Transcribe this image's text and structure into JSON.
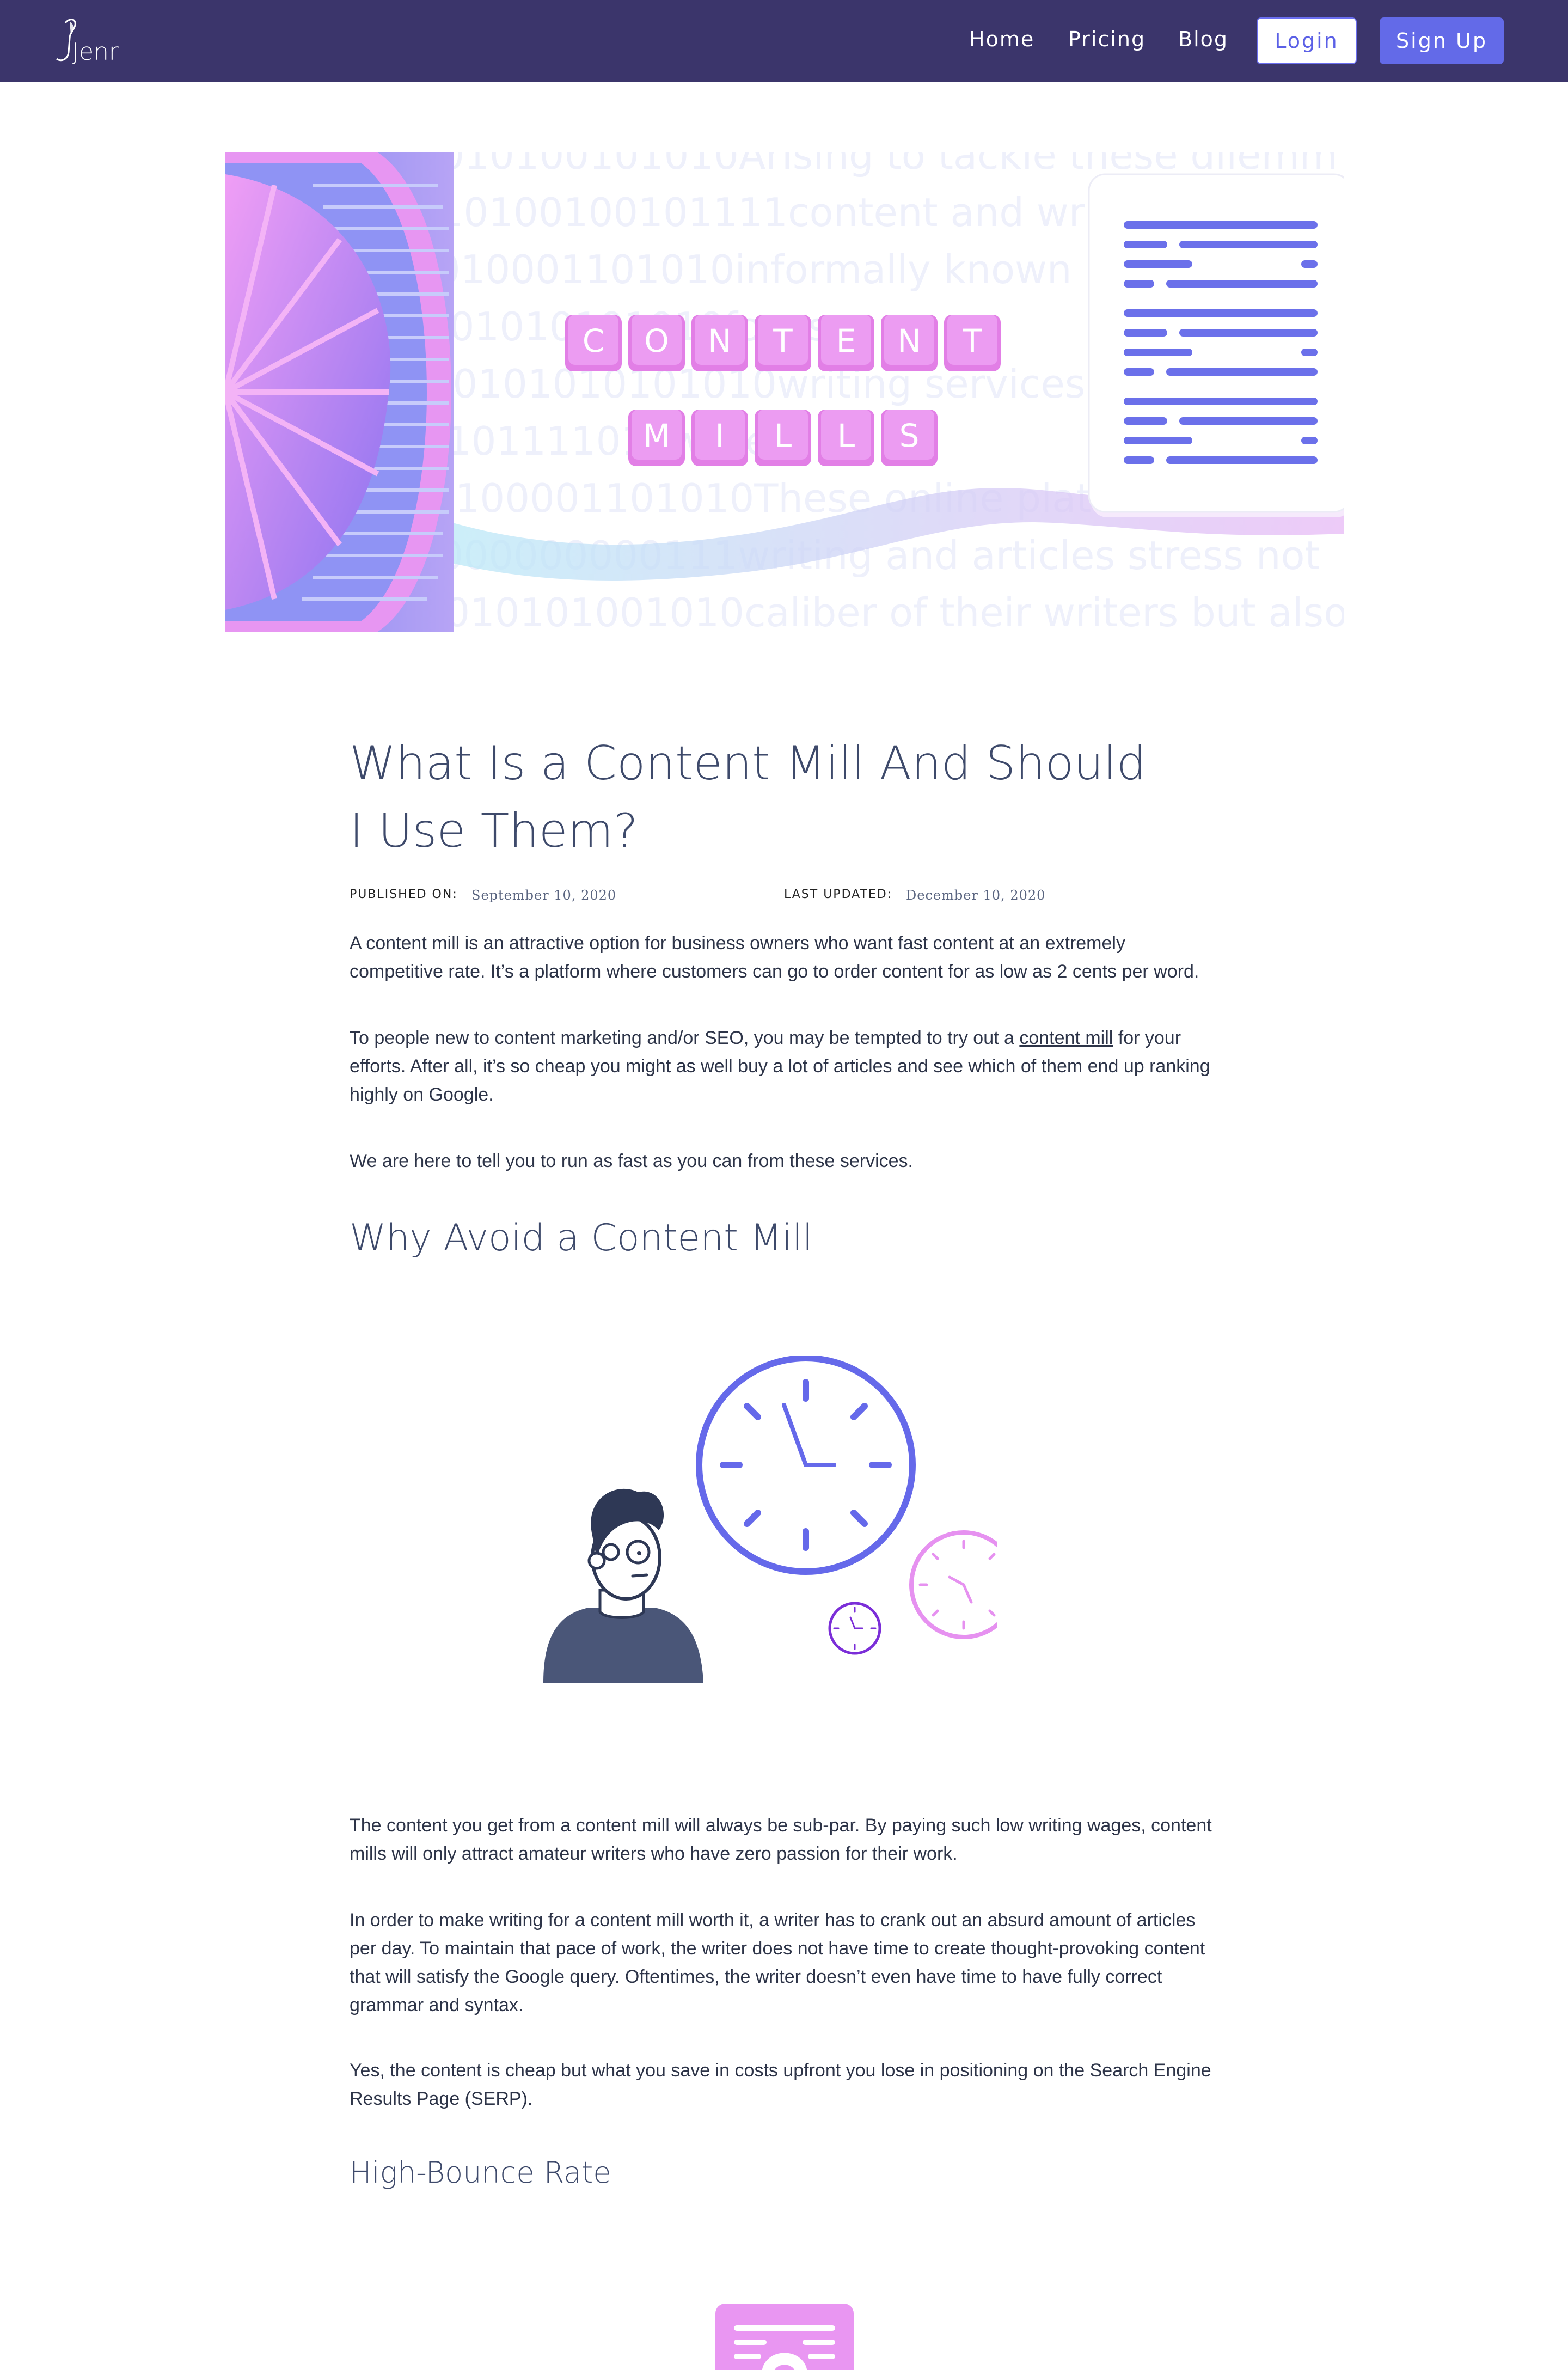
{
  "nav": {
    "logo_text": "Jenni",
    "links": [
      "Home",
      "Pricing",
      "Blog"
    ],
    "login_label": "Login",
    "signup_label": "Sign Up"
  },
  "hero": {
    "tiles_row1": [
      "C",
      "O",
      "N",
      "T",
      "E",
      "N",
      "T"
    ],
    "tiles_row2": [
      "M",
      "I",
      "L",
      "L",
      "S"
    ],
    "background_lines": [
      "0101010100101010Arising to tackle these dilemm",
      "1010100100101111content and writ",
      "1010001101010informally known",
      "0101010101010focus o",
      "0100101010101010writing services",
      "0101111010writers to",
      "01100001101010These online plat",
      "00000000000111writing and articles stress not",
      "0101010101001010caliber of their writers but also"
    ]
  },
  "article": {
    "title": "What Is a Content Mill And Should I Use Them?",
    "published_label": "PUBLISHED ON:",
    "published_date": "September 10, 2020",
    "updated_label": "LAST UPDATED:",
    "updated_date": "December 10, 2020",
    "p1": "A content mill is an attractive option for business owners who want fast content at an extremely competitive rate. It’s a platform where customers can go to order content for as low as 2 cents per word.",
    "p2_before": "To people new to content marketing and/or SEO, you may be tempted to try out a ",
    "p2_link": "content mill",
    "p2_after": " for your efforts. After all, it’s so cheap you might as well buy a lot of articles and see which of them end up ranking highly on Google.",
    "p3": "We are here to tell you to run as fast as you can from these services.",
    "h2_why": "Why Avoid a Content Mill",
    "p4": "The content you get from a content mill will always be sub-par. By paying such low writing wages, content mills will only attract amateur writers who have zero passion for their work.",
    "p5": "In order to make writing for a content mill worth it, a writer has to crank out an absurd amount of articles per day. To maintain that pace of work, the writer does not have time to create thought-provoking content that will satisfy the Google query. Oftentimes, the writer doesn’t even have time to have fully correct grammar and syntax.",
    "p6": "Yes, the content is cheap but what you save in costs upfront you lose in positioning on the Search Engine Results Page (SERP).",
    "h3_bounce": "High-Bounce Rate"
  },
  "colors": {
    "nav_bg": "#3b356b",
    "accent": "#636ae8",
    "pink": "#e48ff0",
    "heading": "#3e4a6b"
  }
}
